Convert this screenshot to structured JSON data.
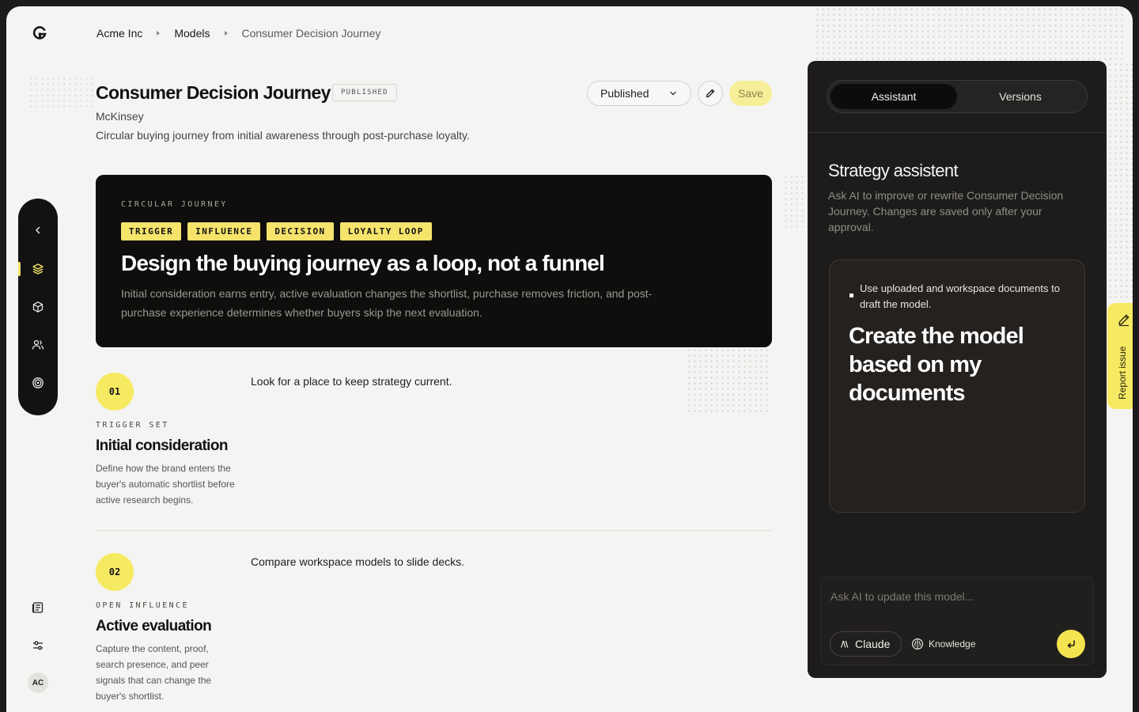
{
  "breadcrumb": {
    "org": "Acme Inc",
    "section": "Models",
    "current": "Consumer Decision Journey"
  },
  "header": {
    "title": "Consumer Decision Journey",
    "badge": "PUBLISHED",
    "author": "McKinsey",
    "description": "Circular buying journey from initial awareness through post-purchase loyalty.",
    "status_value": "Published",
    "save_label": "Save"
  },
  "hero": {
    "eyebrow": "CIRCULAR JOURNEY",
    "tags": [
      "TRIGGER",
      "INFLUENCE",
      "DECISION",
      "LOYALTY LOOP"
    ],
    "title": "Design the buying journey as a loop, not a funnel",
    "body": "Initial consideration earns entry, active evaluation changes the shortlist, purchase removes friction, and post-purchase experience determines whether buyers skip the next evaluation."
  },
  "steps": [
    {
      "number": "01",
      "eyebrow": "TRIGGER SET",
      "title": "Initial consideration",
      "description": "Define how the brand enters the buyer's automatic shortlist before active research begins.",
      "note": "Look for a place to keep strategy current."
    },
    {
      "number": "02",
      "eyebrow": "OPEN INFLUENCE",
      "title": "Active evaluation",
      "description": "Capture the content, proof, search presence, and peer signals that can change the buyer's shortlist.",
      "note": "Compare workspace models to slide decks."
    }
  ],
  "user": {
    "initials": "AC"
  },
  "assistant": {
    "tabs": {
      "assistant": "Assistant",
      "versions": "Versions"
    },
    "title": "Strategy assistent",
    "description": "Ask AI to improve or rewrite Consumer Decision Journey. Changes are saved only after your approval.",
    "card_hint": "Use uploaded and workspace documents to draft the model.",
    "card_title": "Create the model based on my documents",
    "input_placeholder": "Ask AI to update this model...",
    "model_label": "Claude",
    "knowledge_label": "Knowledge"
  },
  "report": {
    "label": "Report issue"
  },
  "colors": {
    "accent": "#f5e36b",
    "dark_panel": "#1e1c1b",
    "hero_bg": "#0f0e0d",
    "page_bg": "#f4f4f3"
  }
}
